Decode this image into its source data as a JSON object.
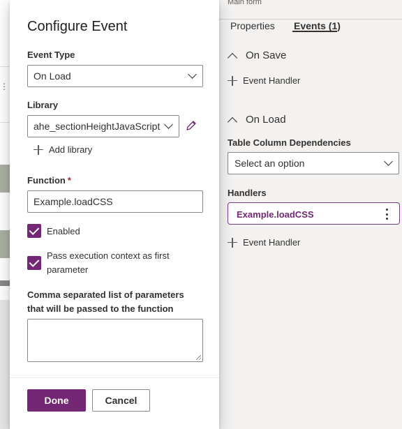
{
  "right_panel": {
    "header_label": "Main form",
    "tabs": [
      {
        "label": "Properties",
        "active": false
      },
      {
        "label": "Events (1)",
        "active": true
      }
    ],
    "on_save": {
      "title": "On Save",
      "add_handler_label": "Event Handler"
    },
    "on_load": {
      "title": "On Load",
      "deps_label": "Table Column Dependencies",
      "deps_placeholder": "Select an option",
      "handlers_label": "Handlers",
      "handlers": [
        {
          "name": "Example.loadCSS"
        }
      ],
      "add_handler_label": "Event Handler"
    }
  },
  "dialog": {
    "title": "Configure Event",
    "event_type": {
      "label": "Event Type",
      "value": "On Load"
    },
    "library": {
      "label": "Library",
      "value": "ahe_sectionHeightJavaScript",
      "add_label": "Add library"
    },
    "function": {
      "label": "Function",
      "required_mark": "*",
      "value": "Example.loadCSS"
    },
    "enabled": {
      "label": "Enabled",
      "checked": true
    },
    "pass_context": {
      "label": "Pass execution context as first parameter",
      "checked": true
    },
    "params": {
      "label": "Comma separated list of parameters that will be passed to the function",
      "value": ""
    },
    "done_label": "Done",
    "cancel_label": "Cancel"
  },
  "colors": {
    "accent": "#742774",
    "required": "#a4262c",
    "panel_bg": "#f3f2f1"
  },
  "icons": [
    "chevron-down-icon",
    "chevron-up-icon",
    "pencil-icon",
    "plus-icon",
    "checkmark-icon",
    "more-vertical-icon"
  ]
}
